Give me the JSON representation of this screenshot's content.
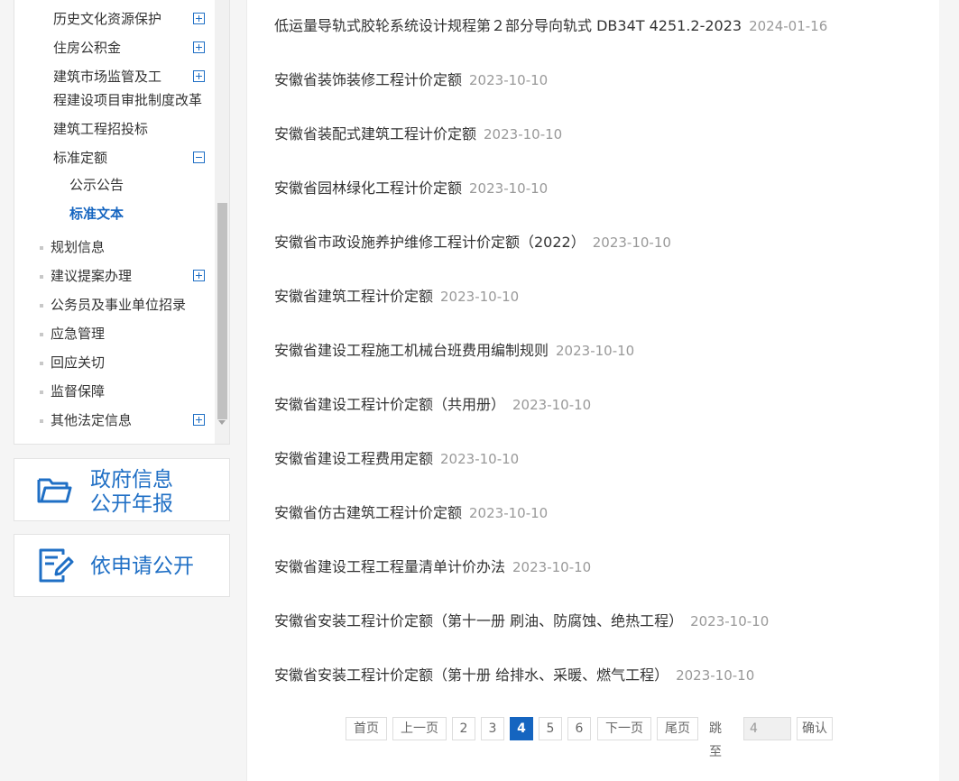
{
  "sidebar": {
    "items": [
      {
        "label": "历史文化资源保护",
        "toggle": "plus"
      },
      {
        "label": "住房公积金",
        "toggle": "plus"
      },
      {
        "label": "建筑市场监管及工",
        "toggle": "plus"
      },
      {
        "label": "程建设项目审批制度改革"
      },
      {
        "label": "建筑工程招投标"
      },
      {
        "label": "标准定额",
        "toggle": "minus"
      },
      {
        "label": "公示公告"
      },
      {
        "label": "标准文本",
        "active": true
      },
      {
        "label": "规划信息"
      },
      {
        "label": "建议提案办理",
        "toggle": "plus"
      },
      {
        "label": "公务员及事业单位招录"
      },
      {
        "label": "应急管理"
      },
      {
        "label": "回应关切"
      },
      {
        "label": "监督保障"
      },
      {
        "label": "其他法定信息",
        "toggle": "plus"
      }
    ]
  },
  "banners": {
    "annual_report_line1": "政府信息",
    "annual_report_line2": "公开年报",
    "apply": "依申请公开"
  },
  "documents": [
    {
      "title": "低运量导轨式胶轮系统设计规程第２部分导向轨式 DB34T 4251.2-2023",
      "date": "2024-01-16"
    },
    {
      "title": "安徽省装饰装修工程计价定额",
      "date": "2023-10-10"
    },
    {
      "title": "安徽省装配式建筑工程计价定额",
      "date": "2023-10-10"
    },
    {
      "title": "安徽省园林绿化工程计价定额",
      "date": "2023-10-10"
    },
    {
      "title": "安徽省市政设施养护维修工程计价定额（2022）",
      "date": "2023-10-10"
    },
    {
      "title": "安徽省建筑工程计价定额",
      "date": "2023-10-10"
    },
    {
      "title": "安徽省建设工程施工机械台班费用编制规则",
      "date": "2023-10-10"
    },
    {
      "title": "安徽省建设工程计价定额（共用册）",
      "date": "2023-10-10"
    },
    {
      "title": "安徽省建设工程费用定额",
      "date": "2023-10-10"
    },
    {
      "title": "安徽省仿古建筑工程计价定额",
      "date": "2023-10-10"
    },
    {
      "title": "安徽省建设工程工程量清单计价办法",
      "date": "2023-10-10"
    },
    {
      "title": "安徽省安装工程计价定额（第十一册 刷油、防腐蚀、绝热工程）",
      "date": "2023-10-10"
    },
    {
      "title": "安徽省安装工程计价定额（第十册 给排水、采暖、燃气工程）",
      "date": "2023-10-10"
    }
  ],
  "pagination": {
    "first": "首页",
    "prev": "上一页",
    "pages": [
      "2",
      "3",
      "4",
      "5",
      "6"
    ],
    "current": "4",
    "next": "下一页",
    "last": "尾页",
    "jump_label": "跳至",
    "jump_value": "4",
    "confirm": "确认"
  },
  "colors": {
    "accent": "#1565c0",
    "date": "#999999"
  }
}
